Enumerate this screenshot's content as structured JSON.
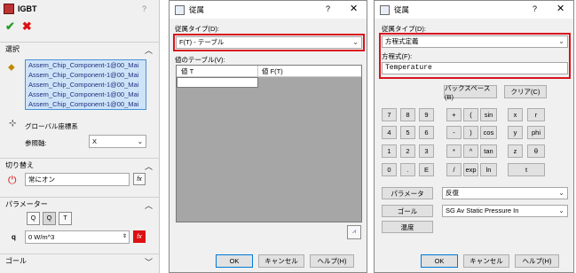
{
  "pm": {
    "feature_title": "IGBT",
    "help": "?",
    "sections": {
      "selection": "選択",
      "switch": "切り替え",
      "parameter": "パラメーター",
      "goal": "ゴール"
    },
    "components": [
      "Assem_Chip_Component-1@00_Mai",
      "Assem_Chip_Component-1@00_Mai",
      "Assem_Chip_Component-1@00_Mai",
      "Assem_Chip_Component-1@00_Mai",
      "Assem_Chip_Component-1@00_Mai"
    ],
    "coord_system": "グローバル座標系",
    "ref_axis_label": "参照軸:",
    "ref_axis_value": "X",
    "switch_value": "常にオン",
    "q_label": "q",
    "q_value": "0 W/m^3",
    "fx": "fx"
  },
  "dlg1": {
    "title": "従属",
    "help": "?",
    "dep_type_label": "従属タイプ(D):",
    "dep_type_value": "F(T) - テーブル",
    "table_label": "値のテーブル(V):",
    "col1": "値 T",
    "col2": "値 F(T)",
    "ok": "OK",
    "cancel": "キャンセル",
    "helpbtn": "ヘルプ(H)"
  },
  "dlg2": {
    "title": "従属",
    "help": "?",
    "dep_type_label": "従属タイプ(D):",
    "dep_type_value": "方程式定義",
    "formula_label": "方程式(F):",
    "formula_value": "Temperature",
    "backspace": "バックスペース(B)",
    "clear": "クリア(C)",
    "keys": [
      [
        "7",
        "8",
        "9"
      ],
      [
        "4",
        "5",
        "6"
      ],
      [
        "1",
        "2",
        "3"
      ],
      [
        "0",
        ".",
        "E"
      ]
    ],
    "ops": [
      [
        "+",
        "(",
        "sin"
      ],
      [
        "-",
        ")",
        "cos"
      ],
      [
        "*",
        "^",
        "tan"
      ],
      [
        "/",
        "exp",
        "ln"
      ]
    ],
    "vars": [
      [
        "x",
        "r"
      ],
      [
        "y",
        "phi"
      ],
      [
        "z",
        "θ"
      ],
      [
        "t",
        ""
      ]
    ],
    "parameter_btn": "パラメータ",
    "parameter_value": "反復",
    "goal_btn": "ゴール",
    "goal_value": "SG Av Static Pressure In",
    "temp_btn": "温度",
    "ok": "OK",
    "cancel": "キャンセル",
    "helpbtn": "ヘルプ(H)"
  }
}
